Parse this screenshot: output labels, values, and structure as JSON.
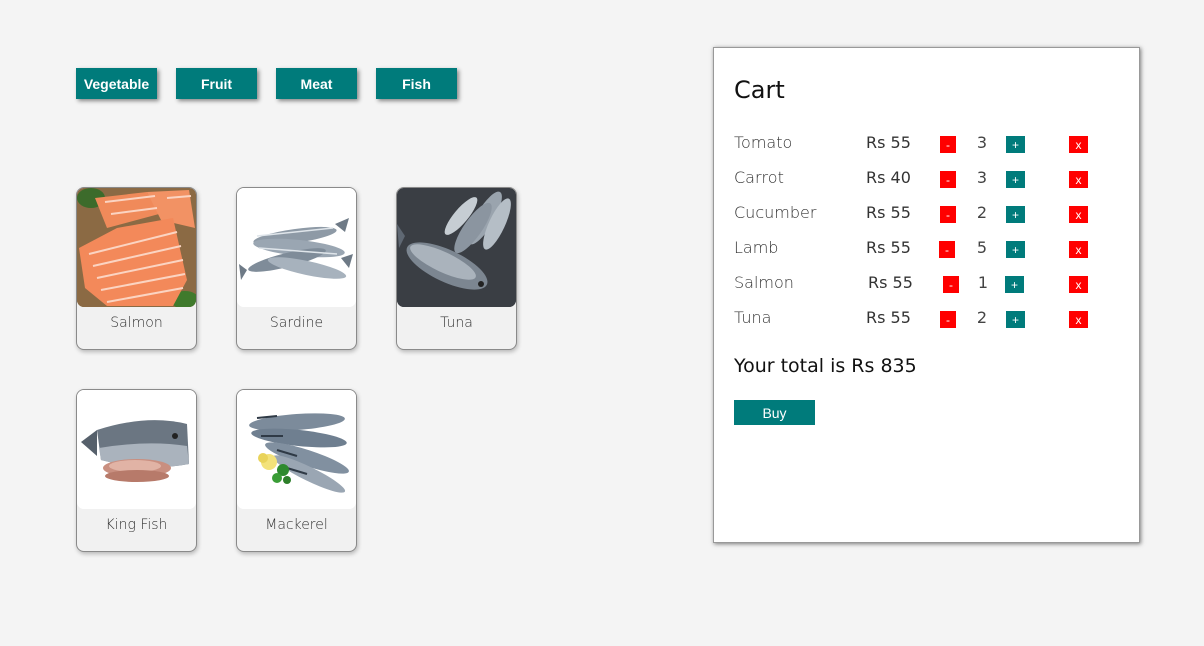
{
  "categories": [
    "Vegetable",
    "Fruit",
    "Meat",
    "Fish"
  ],
  "products": [
    {
      "name": "Salmon",
      "image": "salmon-fillet-photo"
    },
    {
      "name": "Sardine",
      "image": "sardines-photo"
    },
    {
      "name": "Tuna",
      "image": "tuna-pile-photo"
    },
    {
      "name": "King Fish",
      "image": "king-fish-photo"
    },
    {
      "name": "Mackerel",
      "image": "mackerel-photo"
    }
  ],
  "cart": {
    "title": "Cart",
    "items": [
      {
        "name": "Tomato",
        "price": "Rs 55",
        "qty": "3"
      },
      {
        "name": "Carrot",
        "price": "Rs 40",
        "qty": "3"
      },
      {
        "name": "Cucumber",
        "price": "Rs 55",
        "qty": "2"
      },
      {
        "name": "Lamb",
        "price": "Rs 55",
        "qty": "5"
      },
      {
        "name": "Salmon",
        "price": "Rs 55",
        "qty": "1"
      },
      {
        "name": "Tuna",
        "price": "Rs 55",
        "qty": "2"
      }
    ],
    "minus_label": "-",
    "plus_label": "+",
    "remove_label": "x",
    "total_text": "Your total is Rs 835",
    "buy_label": "Buy"
  },
  "colors": {
    "accent": "#007b7b",
    "danger": "#ff0000",
    "background": "#f4f4f4"
  }
}
